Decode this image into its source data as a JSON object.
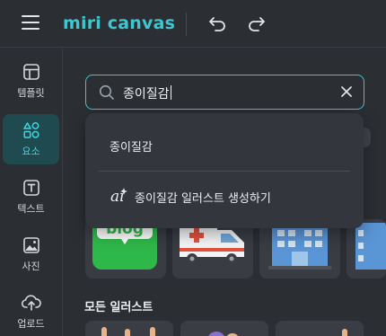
{
  "topbar": {
    "logo_text": "miri canvas",
    "brand_color": "#3cc8d0",
    "icons": [
      "menu-icon",
      "undo-icon",
      "redo-icon"
    ]
  },
  "rail": {
    "items": [
      {
        "label": "템플릿",
        "icon": "template-icon"
      },
      {
        "label": "요소",
        "icon": "elements-icon",
        "active": true
      },
      {
        "label": "텍스트",
        "icon": "text-icon"
      },
      {
        "label": "사진",
        "icon": "photo-icon"
      },
      {
        "label": "업로드",
        "icon": "upload-icon"
      }
    ]
  },
  "search": {
    "value": "종이질감",
    "icon": "search-icon",
    "clear_icon": "close-icon"
  },
  "suggestions": {
    "items": [
      {
        "label": "종이질감"
      },
      {
        "label": "종이질감 일러스트 생성하기",
        "icon": "ai-icon"
      }
    ]
  },
  "results": {
    "thumbs": [
      {
        "name": "blog-sticker",
        "label": "blog"
      },
      {
        "name": "ambulance-illustration"
      },
      {
        "name": "hospital-building-illustration"
      },
      {
        "name": "building-partial"
      }
    ]
  },
  "section": {
    "title": "모든 일러스트"
  }
}
